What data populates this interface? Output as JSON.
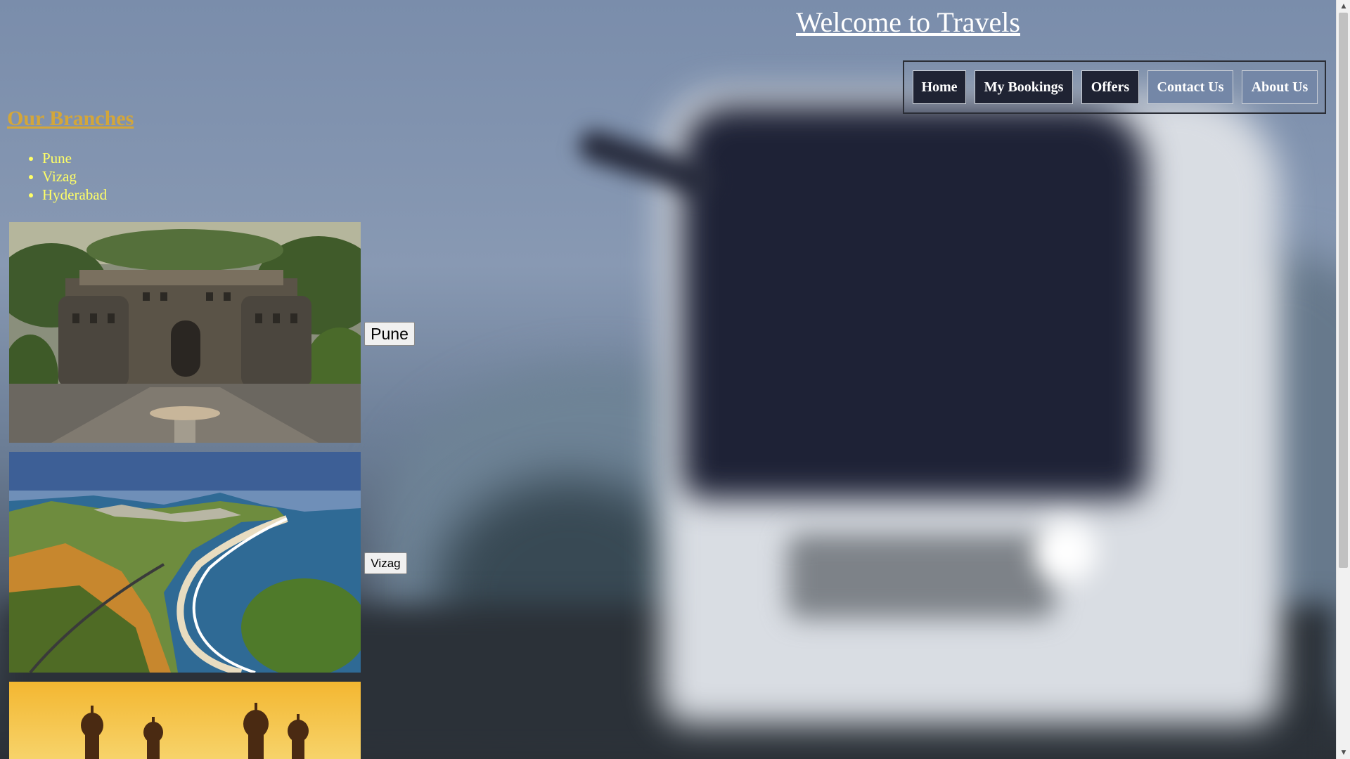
{
  "header": {
    "title": "Welcome to Travels"
  },
  "nav": {
    "items": [
      {
        "label": "Home"
      },
      {
        "label": "My Bookings"
      },
      {
        "label": "Offers"
      },
      {
        "label": "Contact Us"
      },
      {
        "label": "About Us"
      }
    ]
  },
  "branches": {
    "heading": "Our Branches",
    "list": [
      "Pune",
      "Vizag",
      "Hyderabad"
    ],
    "buttons": {
      "pune": "Pune",
      "vizag": "Vizag"
    }
  },
  "colors": {
    "heading_gold": "#d3a63a",
    "list_yellow": "#ffff66",
    "nav_dark": "#1f2333",
    "nav_light": "#7487a7"
  }
}
